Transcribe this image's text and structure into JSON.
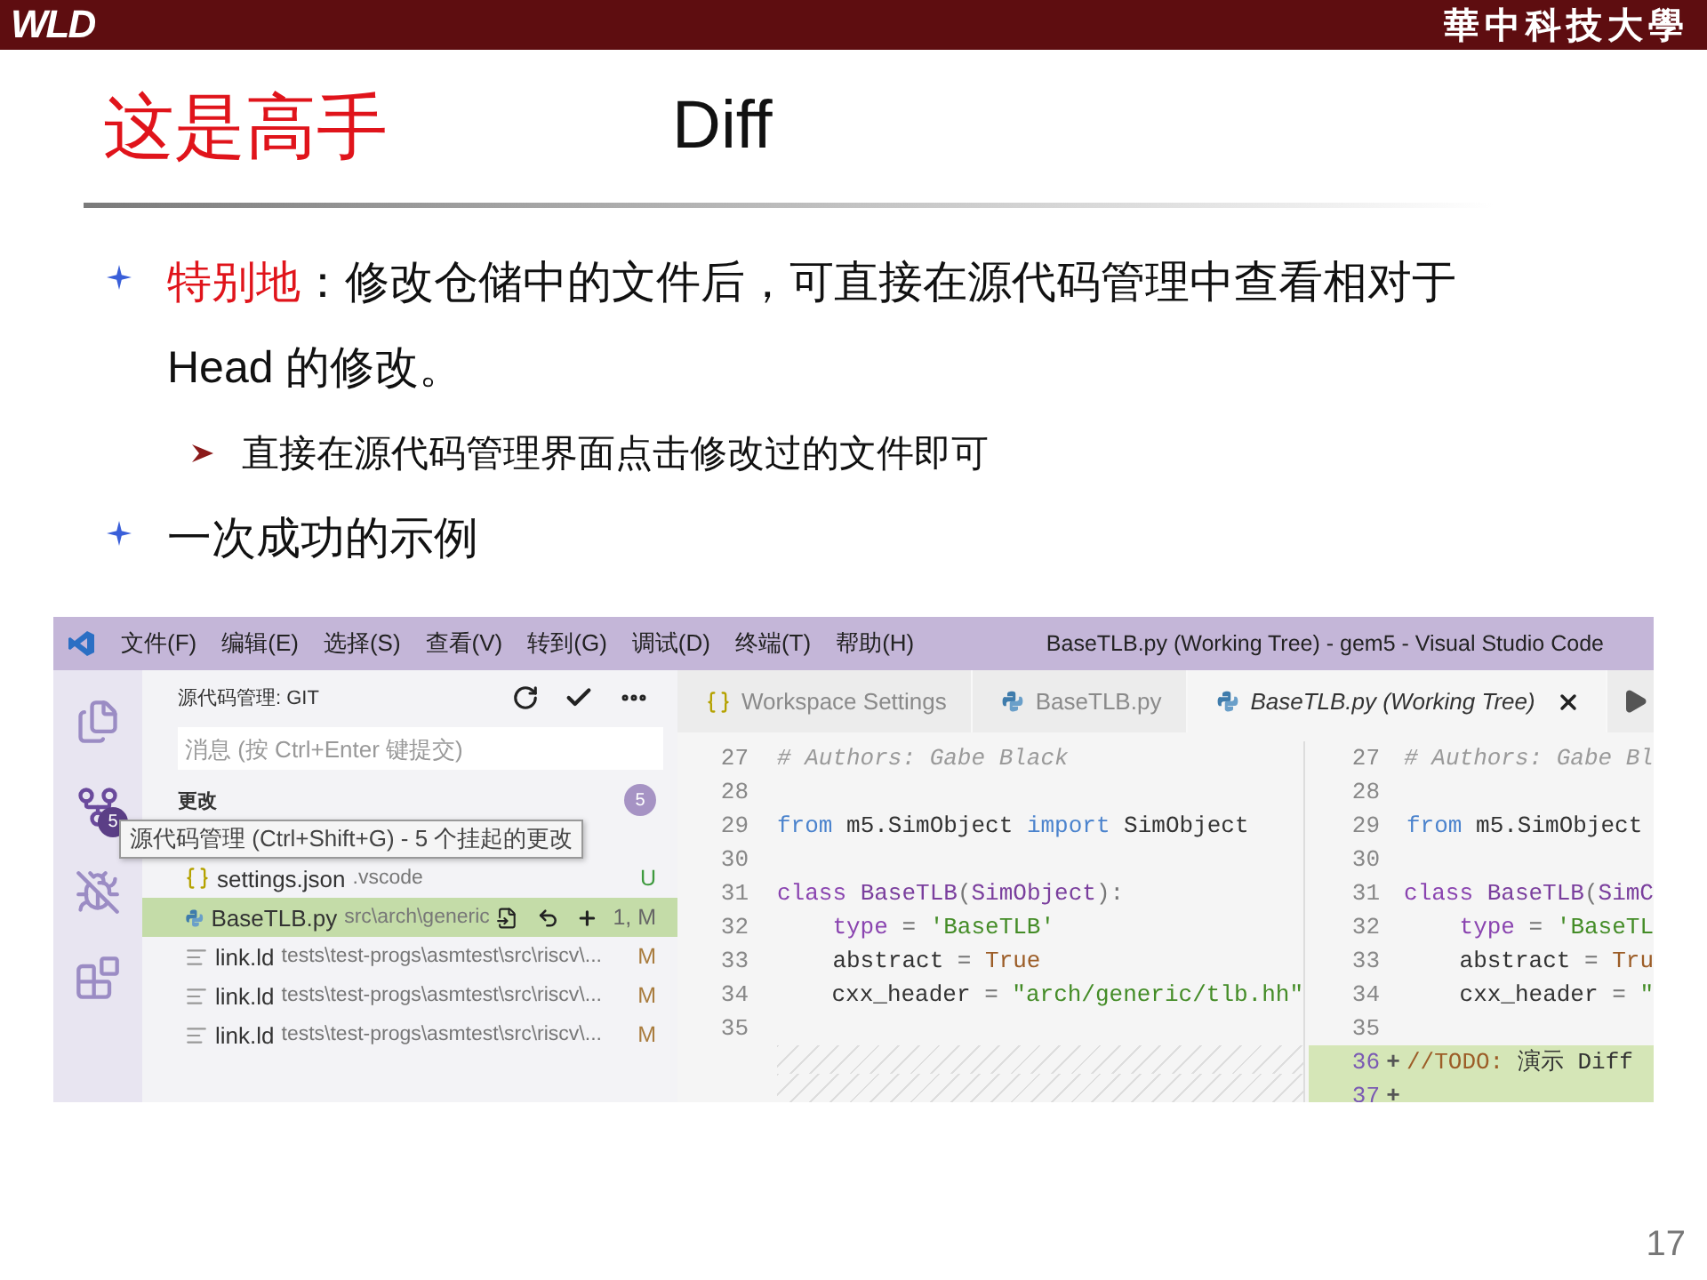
{
  "header": {
    "logo": "WLD",
    "university": "華中科技大學"
  },
  "title": "这是高手",
  "subtitle": "Diff",
  "bullets": [
    {
      "lead": "特别地",
      "text": "：修改仓储中的文件后，可直接在源代码管理中查看相对于Head 的修改。",
      "children": [
        {
          "text": "直接在源代码管理界面点击修改过的文件即可"
        }
      ]
    },
    {
      "text": "一次成功的示例"
    }
  ],
  "vscode": {
    "menu": [
      "文件(F)",
      "编辑(E)",
      "选择(S)",
      "查看(V)",
      "转到(G)",
      "调试(D)",
      "终端(T)",
      "帮助(H)"
    ],
    "title": "BaseTLB.py (Working Tree) - gem5 - Visual Studio Code",
    "activity": [
      {
        "kind": "files",
        "selected": false
      },
      {
        "kind": "scm",
        "selected": true,
        "badge": "5"
      },
      {
        "kind": "debug",
        "selected": false
      },
      {
        "kind": "extensions",
        "selected": false
      }
    ],
    "tooltip": "源代码管理 (Ctrl+Shift+G) - 5 个挂起的更改",
    "sidebar": {
      "title": "源代码管理: GIT",
      "placeholder": "消息 (按 Ctrl+Enter 键提交)",
      "section": "更改",
      "count": "5",
      "files": [
        {
          "kind": "json",
          "name": "settings.json",
          "path": ".vscode",
          "status": "U",
          "color": "#3e9a3e",
          "selected": false
        },
        {
          "kind": "python",
          "name": "BaseTLB.py",
          "path": "src\\arch\\generic",
          "status": "1, M",
          "color": "#666666",
          "selected": true
        },
        {
          "kind": "text",
          "name": "link.ld",
          "path": "tests\\test-progs\\asmtest\\src\\riscv\\...",
          "status": "M",
          "color": "#a97c3e",
          "selected": false
        },
        {
          "kind": "text",
          "name": "link.ld",
          "path": "tests\\test-progs\\asmtest\\src\\riscv\\...",
          "status": "M",
          "color": "#a97c3e",
          "selected": false
        },
        {
          "kind": "text",
          "name": "link.ld",
          "path": "tests\\test-progs\\asmtest\\src\\riscv\\...",
          "status": "M",
          "color": "#a97c3e",
          "selected": false
        }
      ]
    },
    "tabs": [
      {
        "kind": "json",
        "label": "Workspace Settings",
        "selected": false
      },
      {
        "kind": "python",
        "label": "BaseTLB.py",
        "selected": false
      },
      {
        "kind": "python",
        "label": "BaseTLB.py (Working Tree)",
        "selected": true
      }
    ],
    "left": [
      {
        "kind": "code",
        "num": "27",
        "tokens": [
          {
            "t": "# Authors: Gabe Black",
            "kind": "comment"
          }
        ]
      },
      {
        "kind": "code",
        "num": "28"
      },
      {
        "kind": "code",
        "num": "29",
        "tokens": [
          {
            "t": "from",
            "kind": "keyword"
          },
          {
            "t": " m5.SimObject ",
            "kind": "plain"
          },
          {
            "t": "import",
            "kind": "keyword"
          },
          {
            "t": " SimObject",
            "kind": "plain"
          }
        ]
      },
      {
        "kind": "code",
        "num": "30"
      },
      {
        "kind": "code",
        "num": "31",
        "tokens": [
          {
            "t": "class",
            "kind": "storage"
          },
          {
            "t": " BaseTLB",
            "kind": "entity"
          },
          {
            "t": "(",
            "kind": "punct"
          },
          {
            "t": "SimObject",
            "kind": "entity"
          },
          {
            "t": "):",
            "kind": "punct"
          }
        ]
      },
      {
        "kind": "code",
        "num": "32",
        "tokens": [
          {
            "t": "    type",
            "kind": "storage"
          },
          {
            "t": " = ",
            "kind": "punct"
          },
          {
            "t": "'BaseTLB'",
            "kind": "string"
          }
        ]
      },
      {
        "kind": "code",
        "num": "33",
        "tokens": [
          {
            "t": "    abstract",
            "kind": "plain"
          },
          {
            "t": " = ",
            "kind": "punct"
          },
          {
            "t": "True",
            "kind": "constant"
          }
        ]
      },
      {
        "kind": "code",
        "num": "34",
        "tokens": [
          {
            "t": "    cxx_header",
            "kind": "plain"
          },
          {
            "t": " = ",
            "kind": "punct"
          },
          {
            "t": "\"arch/generic/tlb.hh\"",
            "kind": "string"
          }
        ]
      },
      {
        "kind": "code",
        "num": "35"
      },
      {
        "kind": "filler"
      },
      {
        "kind": "filler"
      }
    ],
    "right": [
      {
        "num": "27",
        "added": false,
        "tokens": [
          {
            "t": "# Authors: Gabe Bl",
            "kind": "comment"
          }
        ]
      },
      {
        "num": "28",
        "added": false
      },
      {
        "num": "29",
        "added": false,
        "tokens": [
          {
            "t": "from",
            "kind": "keyword"
          },
          {
            "t": " m5.SimObject",
            "kind": "plain"
          }
        ]
      },
      {
        "num": "30",
        "added": false
      },
      {
        "num": "31",
        "added": false,
        "tokens": [
          {
            "t": "class",
            "kind": "storage"
          },
          {
            "t": " BaseTLB",
            "kind": "entity"
          },
          {
            "t": "(",
            "kind": "punct"
          },
          {
            "t": "SimC",
            "kind": "entity"
          }
        ]
      },
      {
        "num": "32",
        "added": false,
        "tokens": [
          {
            "t": "    type",
            "kind": "storage"
          },
          {
            "t": " = ",
            "kind": "punct"
          },
          {
            "t": "'BaseTL",
            "kind": "string"
          }
        ]
      },
      {
        "num": "33",
        "added": false,
        "tokens": [
          {
            "t": "    abstract",
            "kind": "plain"
          },
          {
            "t": " = ",
            "kind": "punct"
          },
          {
            "t": "Tru",
            "kind": "constant"
          }
        ]
      },
      {
        "num": "34",
        "added": false,
        "tokens": [
          {
            "t": "    cxx_header",
            "kind": "plain"
          },
          {
            "t": " = ",
            "kind": "punct"
          },
          {
            "t": "\"",
            "kind": "string"
          }
        ]
      },
      {
        "num": "35",
        "added": false
      },
      {
        "num": "36",
        "added": true,
        "marker": "+",
        "tokens": [
          {
            "t": "//TODO:",
            "kind": "todo"
          },
          {
            "t": " 演示 Diff",
            "kind": "plain"
          }
        ]
      },
      {
        "num": "37",
        "added": true,
        "marker": "+"
      }
    ]
  },
  "page_number": "17"
}
